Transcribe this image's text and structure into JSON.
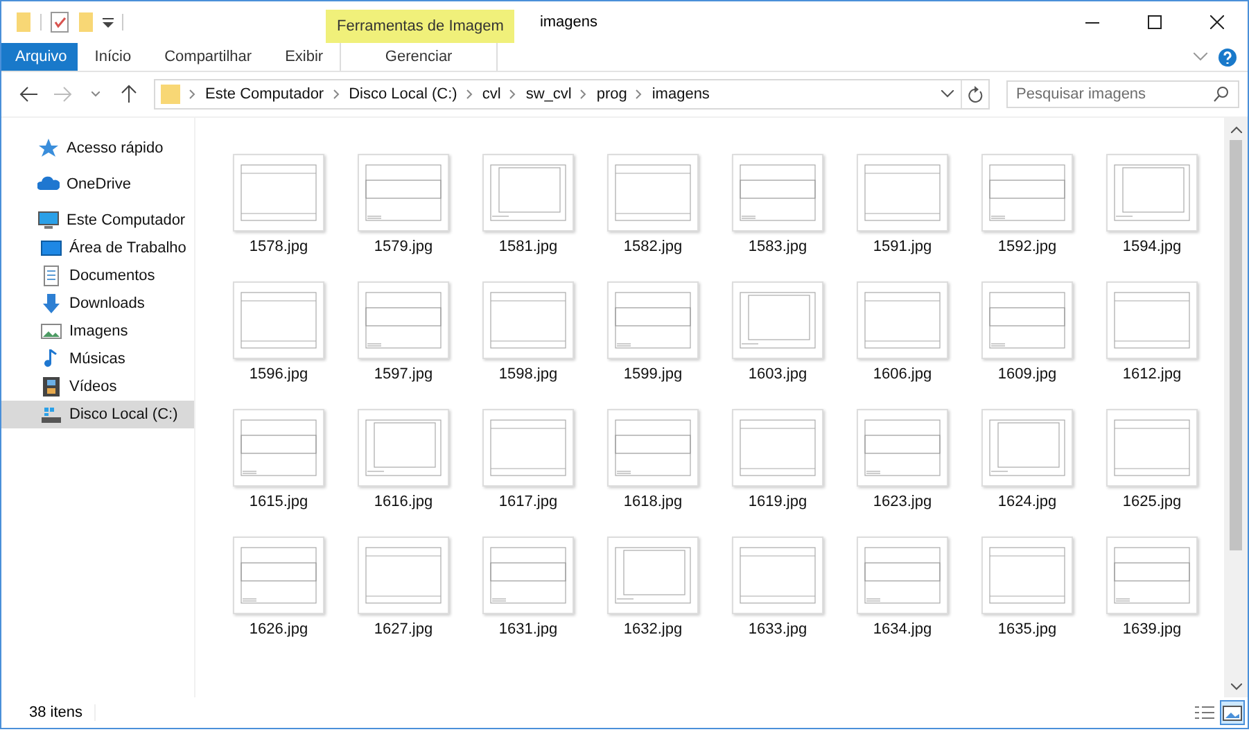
{
  "window": {
    "title": "imagens",
    "contextual_group": "Ferramentas de Imagem"
  },
  "ribbon_tabs": [
    {
      "label": "Arquivo",
      "kind": "file",
      "selected": false
    },
    {
      "label": "Início",
      "kind": "normal",
      "selected": false
    },
    {
      "label": "Compartilhar",
      "kind": "normal",
      "selected": false
    },
    {
      "label": "Exibir",
      "kind": "normal",
      "selected": false
    },
    {
      "label": "Gerenciar",
      "kind": "contextual",
      "selected": false
    }
  ],
  "address_bar": {
    "path": [
      "Este Computador",
      "Disco Local (C:)",
      "cvl",
      "sw_cvl",
      "prog",
      "imagens"
    ]
  },
  "search": {
    "placeholder": "Pesquisar imagens"
  },
  "sidebar": {
    "items": [
      {
        "label": "Acesso rápido",
        "kind": "star",
        "selected": false
      },
      {
        "label": "OneDrive",
        "kind": "cloud",
        "selected": false
      },
      {
        "label": "Este Computador",
        "kind": "computer",
        "selected": false,
        "children": [
          {
            "label": "Área de Trabalho",
            "kind": "desktop",
            "selected": false
          },
          {
            "label": "Documentos",
            "kind": "documents",
            "selected": false
          },
          {
            "label": "Downloads",
            "kind": "downloads",
            "selected": false
          },
          {
            "label": "Imagens",
            "kind": "pictures",
            "selected": false
          },
          {
            "label": "Músicas",
            "kind": "music",
            "selected": false
          },
          {
            "label": "Vídeos",
            "kind": "videos",
            "selected": false
          },
          {
            "label": "Disco Local (C:)",
            "kind": "drive",
            "selected": true
          }
        ]
      }
    ]
  },
  "files": [
    {
      "name": "1578.jpg"
    },
    {
      "name": "1579.jpg"
    },
    {
      "name": "1581.jpg"
    },
    {
      "name": "1582.jpg"
    },
    {
      "name": "1583.jpg"
    },
    {
      "name": "1591.jpg"
    },
    {
      "name": "1592.jpg"
    },
    {
      "name": "1594.jpg"
    },
    {
      "name": "1596.jpg"
    },
    {
      "name": "1597.jpg"
    },
    {
      "name": "1598.jpg"
    },
    {
      "name": "1599.jpg"
    },
    {
      "name": "1603.jpg"
    },
    {
      "name": "1606.jpg"
    },
    {
      "name": "1609.jpg"
    },
    {
      "name": "1612.jpg"
    },
    {
      "name": "1615.jpg"
    },
    {
      "name": "1616.jpg"
    },
    {
      "name": "1617.jpg"
    },
    {
      "name": "1618.jpg"
    },
    {
      "name": "1619.jpg"
    },
    {
      "name": "1623.jpg"
    },
    {
      "name": "1624.jpg"
    },
    {
      "name": "1625.jpg"
    },
    {
      "name": "1626.jpg"
    },
    {
      "name": "1627.jpg"
    },
    {
      "name": "1631.jpg"
    },
    {
      "name": "1632.jpg"
    },
    {
      "name": "1633.jpg"
    },
    {
      "name": "1634.jpg"
    },
    {
      "name": "1635.jpg"
    },
    {
      "name": "1639.jpg"
    }
  ],
  "status_bar": {
    "item_count": "38 itens",
    "views": [
      {
        "kind": "details",
        "selected": false
      },
      {
        "kind": "large_icons",
        "selected": true
      }
    ]
  }
}
